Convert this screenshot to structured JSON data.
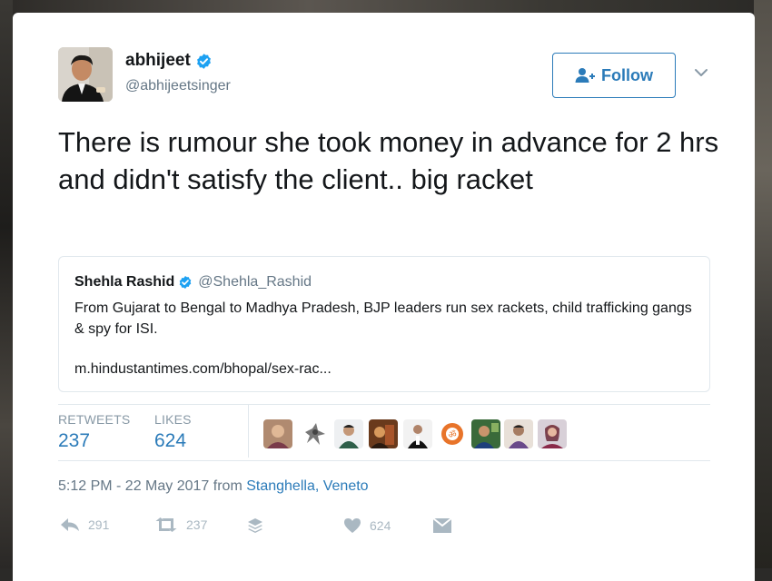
{
  "tweet": {
    "author": {
      "name": "abhijeet",
      "handle": "@abhijeetsinger",
      "verified": true
    },
    "follow_label": "Follow",
    "text": "There is rumour she took money in advance for 2 hrs and didn't satisfy the client.. big racket",
    "quoted": {
      "name": "Shehla Rashid",
      "handle": "@Shehla_Rashid",
      "text": "From Gujarat to Bengal to Madhya Pradesh, BJP leaders run sex rackets, child trafficking gangs & spy for ISI.",
      "link": "m.hindustantimes.com/bhopal/sex-rac..."
    },
    "stats": {
      "retweets_label": "RETWEETS",
      "retweets_value": "237",
      "likes_label": "LIKES",
      "likes_value": "624"
    },
    "timestamp": "5:12 PM - 22 May 2017",
    "from_label": "from",
    "location": "Stanghella, Veneto",
    "actions": {
      "reply_count": "291",
      "retweet_count": "237",
      "like_count": "624"
    }
  },
  "colors": {
    "accent": "#2b7bb9",
    "verified": "#1da1f2",
    "muted": "#657786",
    "action_icons": "#aab8c2"
  },
  "icons": [
    "verified-badge-icon",
    "follow-user-icon",
    "chevron-down-icon",
    "reply-icon",
    "retweet-icon",
    "buffer-stack-icon",
    "heart-icon",
    "direct-message-icon"
  ]
}
